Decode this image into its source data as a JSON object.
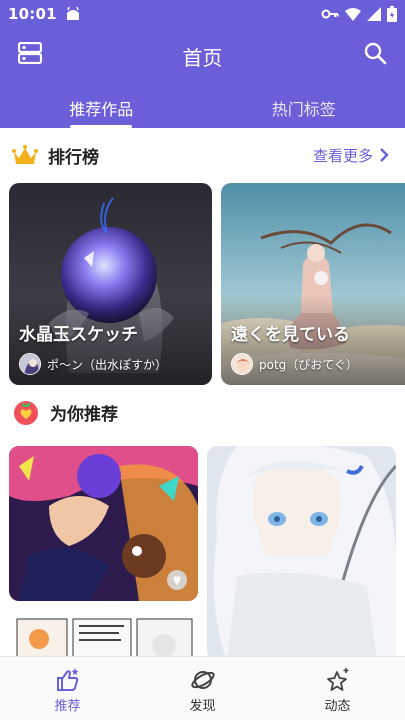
{
  "status_bar": {
    "time": "10:01"
  },
  "app_bar": {
    "title": "首页"
  },
  "tabs": [
    {
      "label": "推荐作品",
      "active": true
    },
    {
      "label": "热门标签",
      "active": false
    }
  ],
  "ranking": {
    "title": "排行榜",
    "more_label": "查看更多",
    "items": [
      {
        "title": "水晶玉スケッチ",
        "author": "ポ〜ン（出水ぽすか）"
      },
      {
        "title": "遠くを見ている",
        "author": "potg（ぴおてぐ）"
      }
    ]
  },
  "recommend": {
    "title": "为你推荐"
  },
  "bottom_nav": [
    {
      "label": "推荐",
      "icon": "thumbs-up-icon",
      "active": true
    },
    {
      "label": "发现",
      "icon": "planet-icon",
      "active": false
    },
    {
      "label": "动态",
      "icon": "sparkle-icon",
      "active": false
    }
  ],
  "colors": {
    "primary": "#6a5fd8",
    "background": "#ffffff"
  }
}
